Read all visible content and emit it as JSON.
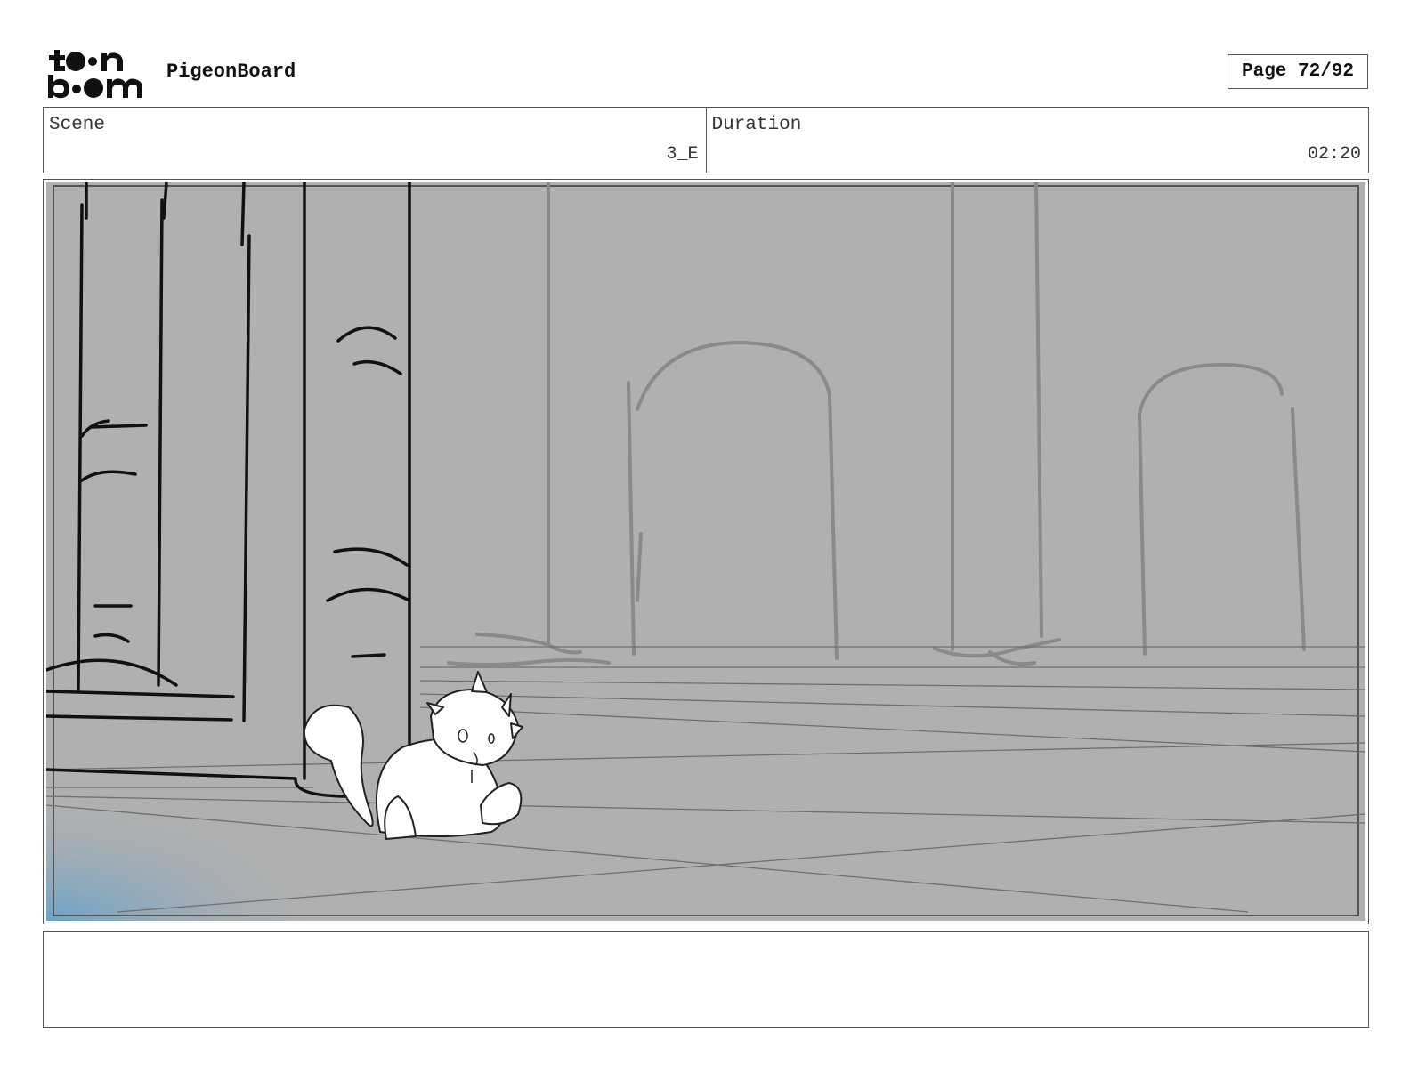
{
  "header": {
    "logo_text": "toon boom",
    "project_title": "PigeonBoard",
    "page_indicator": "Page 72/92"
  },
  "scene_info": {
    "scene_label": "Scene",
    "scene_value": "3_E",
    "duration_label": "Duration",
    "duration_value": "02:20"
  },
  "panel": {
    "description": "Storyboard sketch: white fluffy cat sitting on stone floor near pillars, arched doorways in background",
    "background_color": "#b0b0b0",
    "highlight_color": "#6aa3c9"
  },
  "notes": {
    "text": ""
  }
}
